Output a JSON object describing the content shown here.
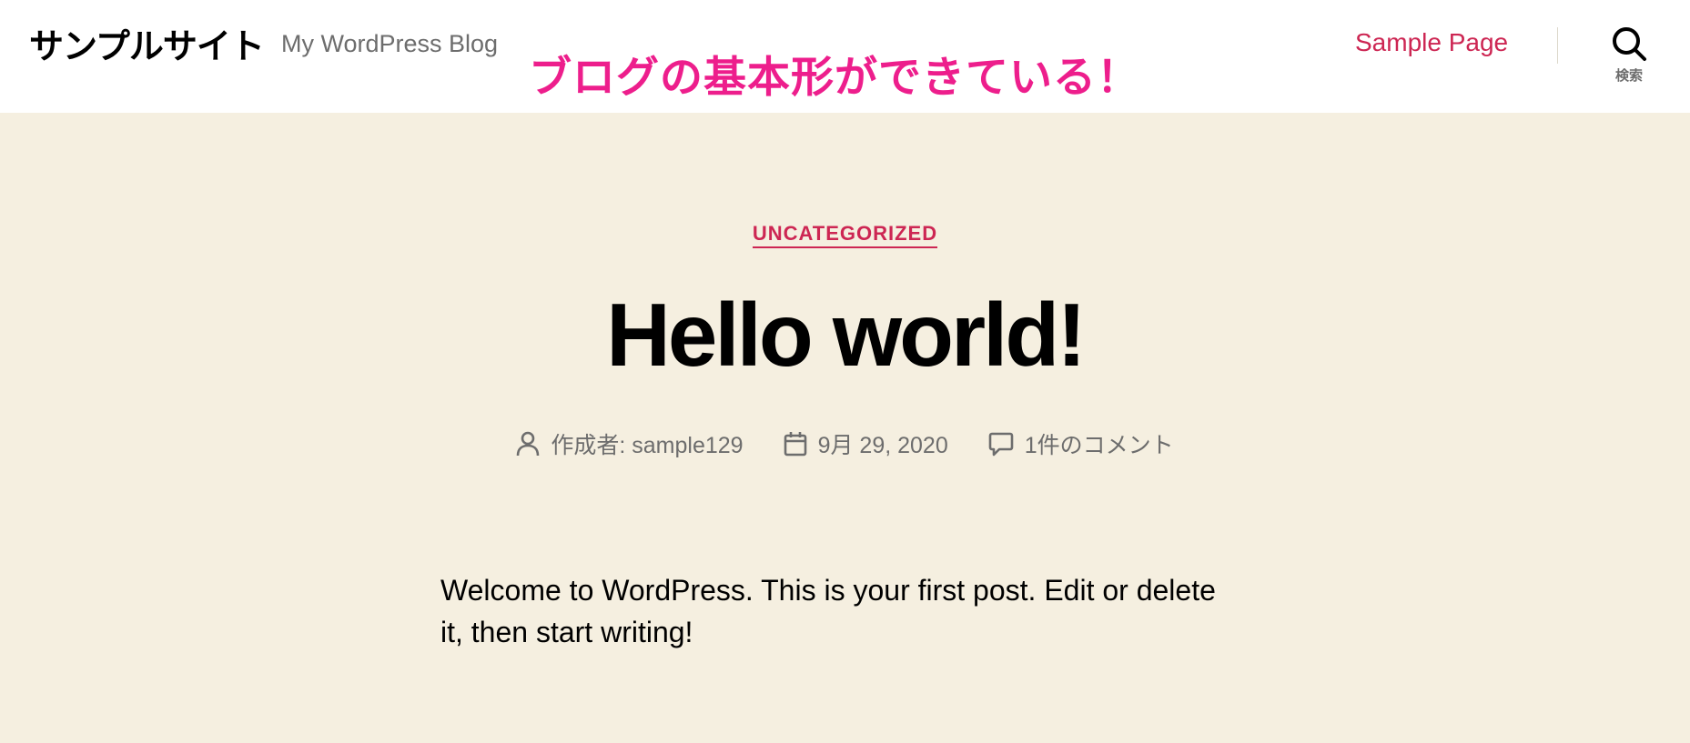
{
  "header": {
    "site_title": "サンプルサイト",
    "site_description": "My WordPress Blog",
    "annotation": "ブログの基本形ができている！",
    "nav_link": "Sample Page",
    "search_label": "検索"
  },
  "post": {
    "category": "UNCATEGORIZED",
    "title": "Hello world!",
    "meta": {
      "author": "作成者: sample129",
      "date": "9月 29, 2020",
      "comments": "1件のコメント"
    },
    "content": "Welcome to WordPress. This is your first post. Edit or delete it, then start writing!"
  },
  "colors": {
    "accent": "#cd2653",
    "annotation": "#ed1e8c",
    "background": "#f5efe0",
    "header_background": "#ffffff",
    "meta_text": "#6d6d6d"
  },
  "icons": {
    "search": "search-icon",
    "author": "user-icon",
    "date": "calendar-icon",
    "comments": "comment-icon"
  }
}
